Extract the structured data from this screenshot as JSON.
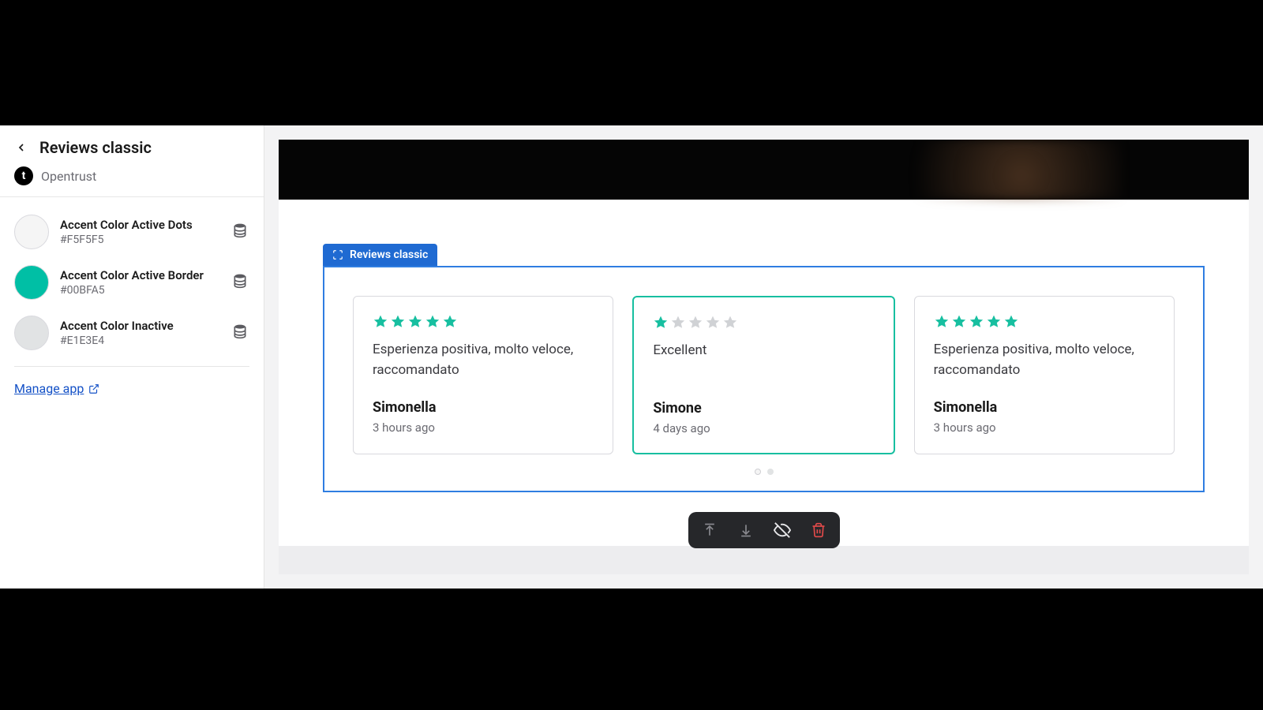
{
  "sidebar": {
    "title": "Reviews classic",
    "app_name": "Opentrust",
    "app_icon_glyph": "t",
    "colors": [
      {
        "label": "Accent Color Active Dots",
        "hex": "#F5F5F5",
        "swatch": "#F5F5F5"
      },
      {
        "label": "Accent Color Active Border",
        "hex": "#00BFA5",
        "swatch": "#00BFA5"
      },
      {
        "label": "Accent Color Inactive",
        "hex": "#E1E3E4",
        "swatch": "#E1E3E4"
      }
    ],
    "manage_link": "Manage app"
  },
  "section": {
    "badge": "Reviews classic",
    "star_color_active": "#17bfa0",
    "star_color_inactive": "#d0d2d5",
    "dots": [
      {
        "active": true
      },
      {
        "active": false
      }
    ],
    "reviews": [
      {
        "rating": 5,
        "text": "Esperienza positiva, molto veloce, raccomandato",
        "author": "Simonella",
        "time": "3 hours ago",
        "highlight": false
      },
      {
        "rating": 1,
        "text": "Excellent",
        "author": "Simone",
        "time": "4 days ago",
        "highlight": true
      },
      {
        "rating": 5,
        "text": "Esperienza positiva, molto veloce, raccomandato",
        "author": "Simonella",
        "time": "3 hours ago",
        "highlight": false
      }
    ]
  },
  "toolbar": {
    "move_up": "move-up",
    "move_down": "move-down",
    "hide": "hide",
    "delete": "delete"
  }
}
